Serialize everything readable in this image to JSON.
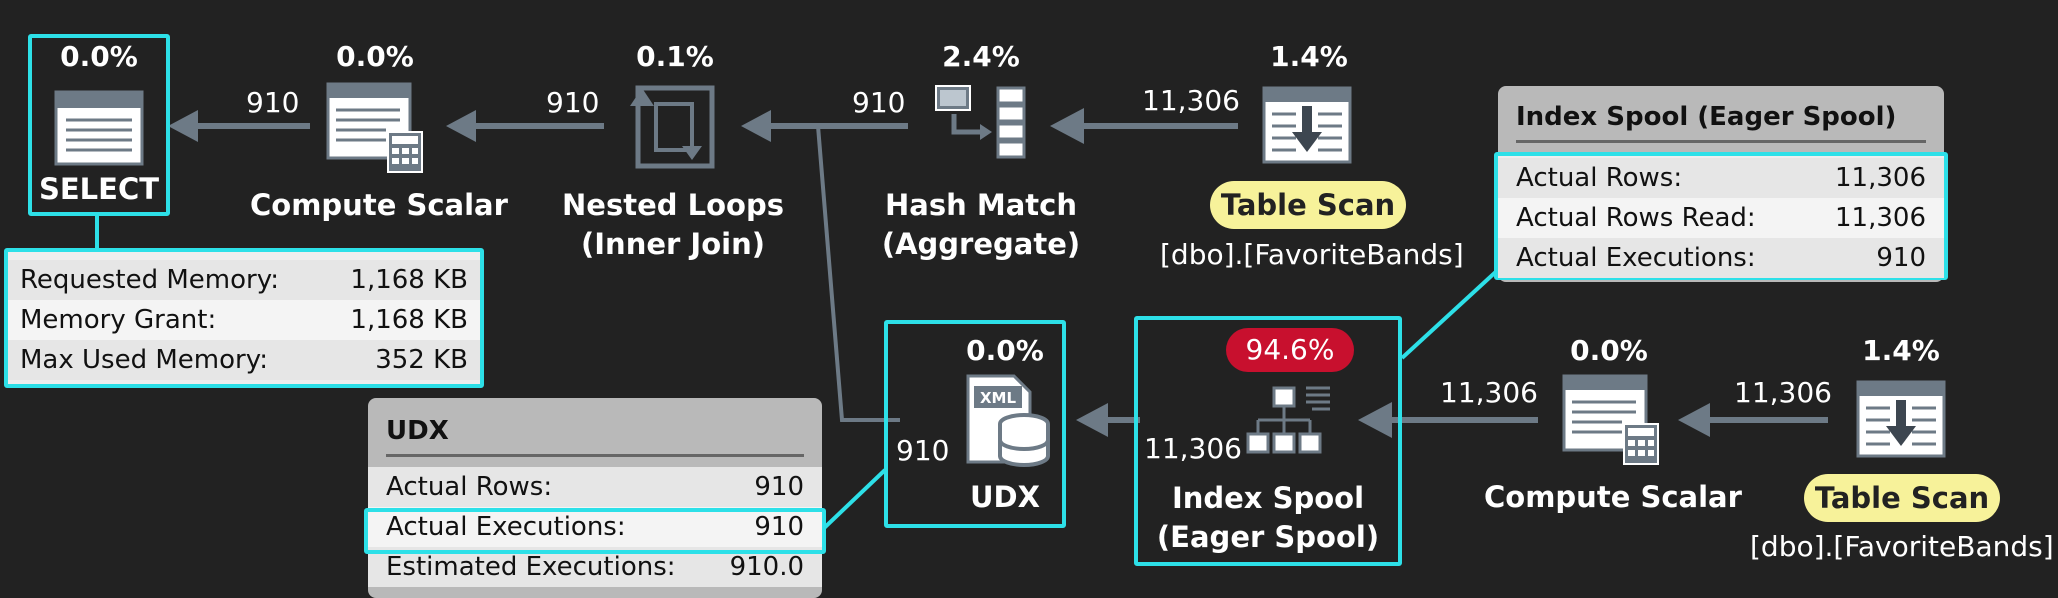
{
  "operators": {
    "select": {
      "pct": "0.0%",
      "label": "SELECT"
    },
    "compute_scalar_top": {
      "pct": "0.0%",
      "label": "Compute Scalar"
    },
    "nested_loops": {
      "pct": "0.1%",
      "label_line1": "Nested Loops",
      "label_line2": "(Inner Join)"
    },
    "hash_match": {
      "pct": "2.4%",
      "label_line1": "Hash Match",
      "label_line2": "(Aggregate)"
    },
    "table_scan_top": {
      "pct": "1.4%",
      "label": "Table Scan",
      "object": "[dbo].[FavoriteBands]"
    },
    "udx": {
      "pct": "0.0%",
      "label": "UDX"
    },
    "index_spool": {
      "pct": "94.6%",
      "label_line1": "Index Spool",
      "label_line2": "(Eager Spool)"
    },
    "compute_scalar_bottom": {
      "pct": "0.0%",
      "label": "Compute Scalar"
    },
    "table_scan_bottom": {
      "pct": "1.4%",
      "label": "Table Scan",
      "object": "[dbo].[FavoriteBands]"
    }
  },
  "row_counts": {
    "select_in": "910",
    "compute_in": "910",
    "nested_in": "910",
    "hash_in": "11,306",
    "udx_in": "910",
    "spool_in_left": "11,306",
    "spool_in_right": "11,306",
    "compute_bottom_in": "11,306"
  },
  "select_tooltip": {
    "rows": [
      {
        "label": "Requested Memory:",
        "value": "1,168 KB"
      },
      {
        "label": "Memory Grant:",
        "value": "1,168 KB"
      },
      {
        "label": "Max Used Memory:",
        "value": "352 KB"
      }
    ]
  },
  "udx_tooltip": {
    "title": "UDX",
    "rows": [
      {
        "label": "Actual Rows:",
        "value": "910"
      },
      {
        "label": "Actual Executions:",
        "value": "910"
      },
      {
        "label": "Estimated Executions:",
        "value": "910.0"
      }
    ]
  },
  "spool_tooltip": {
    "title": "Index Spool (Eager Spool)",
    "rows": [
      {
        "label": "Actual Rows:",
        "value": "11,306"
      },
      {
        "label": "Actual Rows Read:",
        "value": "11,306"
      },
      {
        "label": "Actual Executions:",
        "value": "910"
      }
    ]
  },
  "colors": {
    "background": "#222222",
    "highlight": "#2de0e8",
    "arrow": "#6d7a86",
    "pill": "#f7f29a",
    "cost_badge": "#c8102e"
  }
}
